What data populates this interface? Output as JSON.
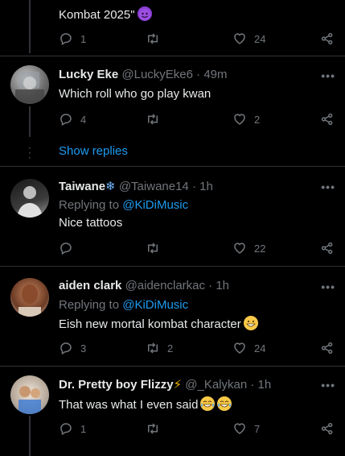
{
  "tweets": [
    {
      "text": "Kombat 2025\"",
      "replies": "1",
      "retweets": "",
      "likes": "24"
    },
    {
      "name": "Lucky Eke",
      "handle": "@LuckyEke6 · 49m",
      "text": "Which roll who go play kwan",
      "replies": "4",
      "retweets": "",
      "likes": "2"
    },
    {
      "name": "Taiwane",
      "handle": "@Taiwane14 · 1h",
      "replying_label": "Replying to",
      "replying_to": "@KiDiMusic",
      "text": "Nice tattoos",
      "replies": "",
      "retweets": "",
      "likes": "22"
    },
    {
      "name": "aiden clark",
      "handle": "@aidenclarkac · 1h",
      "replying_label": "Replying to",
      "replying_to": "@KiDiMusic",
      "text": "Eish new mortal kombat character",
      "replies": "3",
      "retweets": "2",
      "likes": "24"
    },
    {
      "name": "Dr. Pretty boy Flizzy",
      "handle": "@_Kalykan · 1h",
      "text": "That was what I even said",
      "replies": "1",
      "retweets": "",
      "likes": "7"
    }
  ],
  "show_replies": "Show replies",
  "more_label": "•••",
  "icons": [
    "reply-icon",
    "retweet-icon",
    "like-icon",
    "share-icon",
    "more-icon",
    "devil-emoji",
    "snowflake-emoji",
    "grin-emoji",
    "lightning-emoji",
    "tears-of-joy-emoji"
  ]
}
